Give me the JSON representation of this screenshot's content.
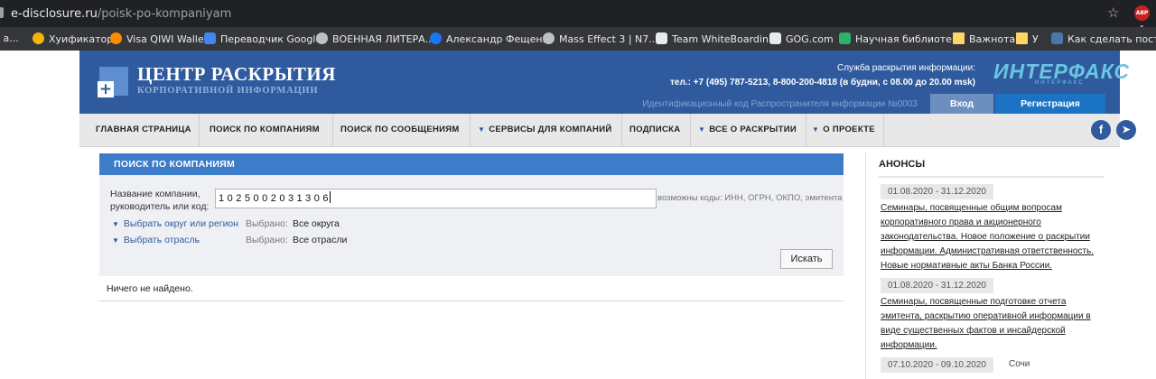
{
  "browser": {
    "url_host": "e-disclosure.ru",
    "url_path": "/poisk-po-kompaniyam",
    "ext_badge": "ABP 5",
    "bookmarks": [
      {
        "label": "с а...",
        "icon_color": "#e8eaed",
        "round": false
      },
      {
        "label": "Хуификатор",
        "icon_color": "#f5b400",
        "round": true
      },
      {
        "label": "Visa QIWI Wallet",
        "icon_color": "#ff8c00",
        "round": true
      },
      {
        "label": "Переводчик Google",
        "icon_color": "#4285f4",
        "round": false
      },
      {
        "label": "ВОЕННАЯ ЛИТЕРА...",
        "icon_color": "#bdc1c6",
        "round": true
      },
      {
        "label": "Александр Фещенко",
        "icon_color": "#1877f2",
        "round": true
      },
      {
        "label": "Mass Effect 3 | N7...",
        "icon_color": "#bdc1c6",
        "round": true
      },
      {
        "label": "Team WhiteBoardin...",
        "icon_color": "#e8eaed",
        "round": false
      },
      {
        "label": "GOG.com",
        "icon_color": "#e8eaed",
        "round": false
      },
      {
        "label": "Научная библиоте...",
        "icon_color": "#2bb36a",
        "round": false
      },
      {
        "label": "Важнота",
        "icon_color": "#fdd663",
        "round": false
      },
      {
        "label": "У",
        "icon_color": "#fdd663",
        "round": false
      },
      {
        "label": "Как сделать посты...",
        "icon_color": "#4a76a8",
        "round": false
      }
    ]
  },
  "header": {
    "title": "ЦЕНТР РАСКРЫТИЯ",
    "subtitle": "КОРПОРАТИВНОЙ ИНФОРМАЦИИ",
    "service_label": "Служба раскрытия информации:",
    "phones": "тел.: +7 (495) 787-5213, 8-800-200-4818 (в будни, с 08.00 до 20.00 msk)",
    "ident": "Идентификационный код Распространителя информации №0003",
    "partner_logo": "ИНТЕРФАКС",
    "partner_sub": "ИНТЕРФАКС",
    "login": "Вход",
    "register": "Регистрация"
  },
  "nav": {
    "items": [
      {
        "label": "ГЛАВНАЯ СТРАНИЦА",
        "arrow": ""
      },
      {
        "label": "ПОИСК ПО КОМПАНИЯМ",
        "arrow": ""
      },
      {
        "label": "ПОИСК ПО СООБЩЕНИЯМ",
        "arrow": ""
      },
      {
        "label": "СЕРВИСЫ ДЛЯ КОМПАНИЙ",
        "arrow": "▼"
      },
      {
        "label": "ПОДПИСКА",
        "arrow": ""
      },
      {
        "label": "ВСЕ О РАСКРЫТИИ",
        "arrow": "▼"
      },
      {
        "label": "О ПРОЕКТЕ",
        "arrow": "▼"
      }
    ],
    "facebook": "f",
    "telegram": "➤"
  },
  "search": {
    "heading": "ПОИСК ПО КОМПАНИЯМ",
    "name_label": "Название компании, руководитель или код:",
    "query": "1025002031306",
    "codes_hint": "возможны коды: ИНН, ОГРН, ОКПО, эмитента",
    "region_link": "Выбрать округ или регион",
    "industry_link": "Выбрать отрасль",
    "selected_label": "Выбрано:",
    "region_value": "Все округа",
    "industry_value": "Все отрасли",
    "button": "Искать",
    "no_results": "Ничего не найдено."
  },
  "announcements": {
    "title": "АНОНСЫ",
    "items": [
      {
        "date": "01.08.2020 - 31.12.2020",
        "place": "",
        "text": "Семинары, посвященные общим вопросам корпоративного права и акционерного законодательства. Новое положение о раскрытии информации. Административная ответственность. Новые нормативные акты Банка России."
      },
      {
        "date": "01.08.2020 - 31.12.2020",
        "place": "",
        "text": "Семинары, посвященные подготовке отчета эмитента, раскрытию оперативной информации в виде существенных фактов и инсайдерской информации."
      },
      {
        "date": "07.10.2020 - 09.10.2020",
        "place": "Сочи",
        "text": ""
      }
    ]
  }
}
